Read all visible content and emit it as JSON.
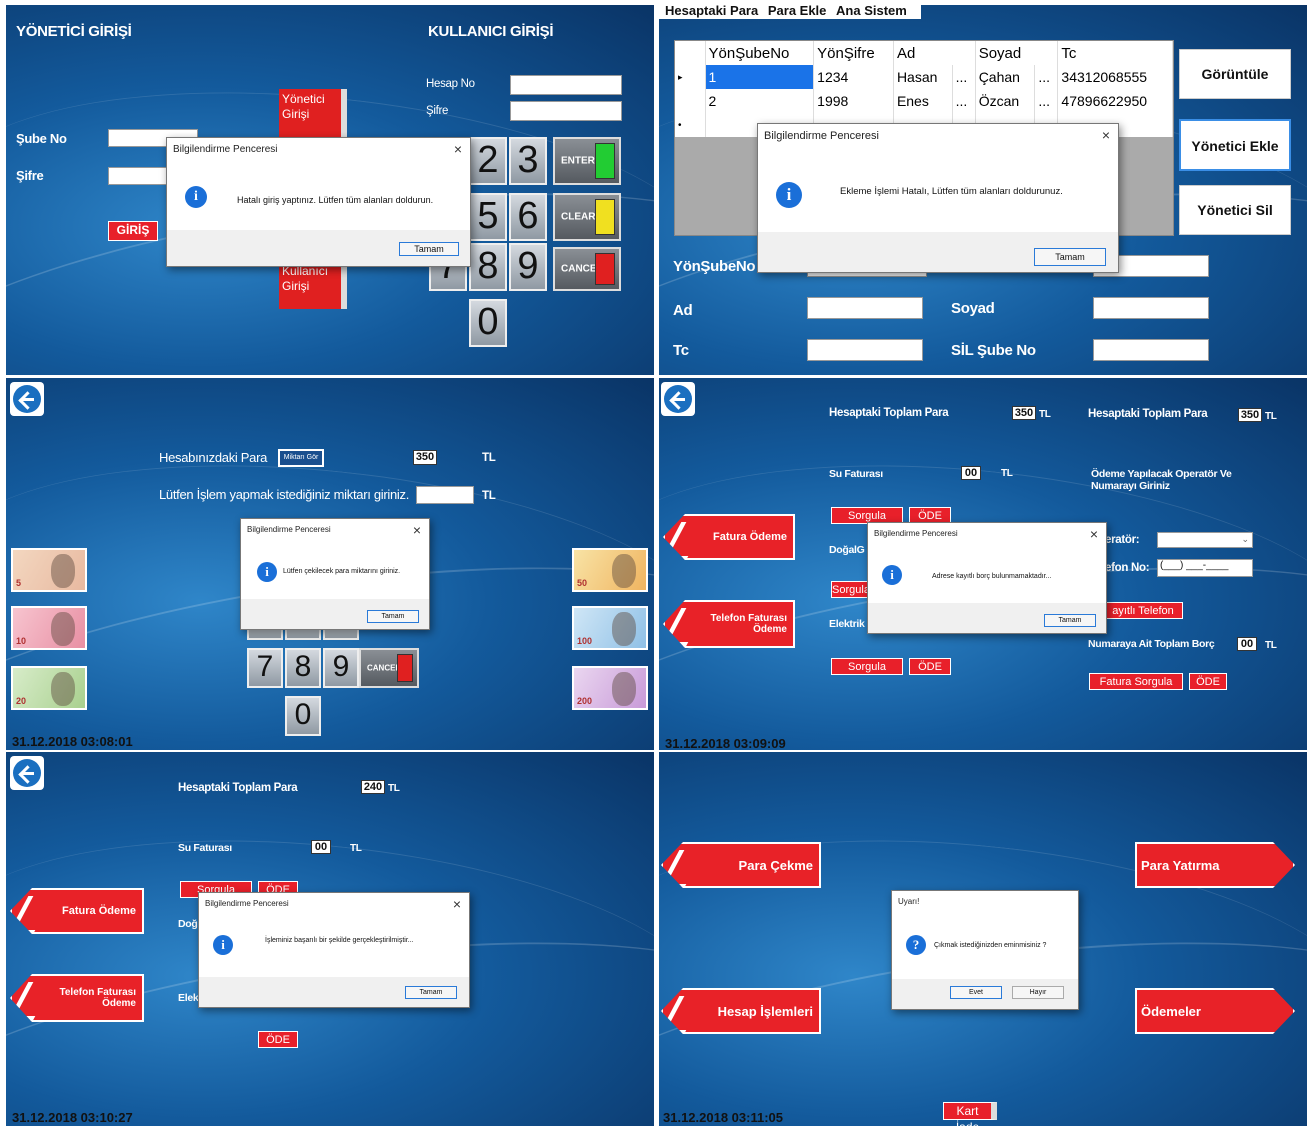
{
  "p1": {
    "admin_title": "YÖNETİCİ GİRİŞİ",
    "user_title": "KULLANICI GİRİŞİ",
    "branch_label": "Şube No",
    "pass_label": "Şifre",
    "login_button": "GİRİŞ",
    "admin_side_button": "Yönetici Girişi",
    "user_side_button": "Kullanıcı Girişi",
    "account_label": "Hesap No",
    "user_pass_label": "Şifre",
    "keys": [
      "2",
      "3",
      "5",
      "6",
      "7",
      "8",
      "9",
      "0"
    ],
    "enter": "ENTER",
    "clear": "CLEAR",
    "cancel": "CANCEL",
    "dialog": {
      "title": "Bilgilendirme Penceresi",
      "message": "Hatalı giriş yaptınız. Lütfen tüm alanları doldurun.",
      "ok": "Tamam"
    }
  },
  "p2": {
    "menu": [
      "Hesaptaki Para",
      "Para Ekle",
      "Ana Sistem"
    ],
    "columns": [
      "YönŞubeNo",
      "YönŞifre",
      "Ad",
      "Soyad",
      "Tc"
    ],
    "rows": [
      [
        "1",
        "1234",
        "Hasan",
        "Çahan",
        "34312068555"
      ],
      [
        "2",
        "1998",
        "Enes",
        "Özcan",
        "47896622950"
      ]
    ],
    "ellipsis": "...",
    "buttons": [
      "Görüntüle",
      "Yönetici Ekle",
      "Yönetici Sil"
    ],
    "branch_label": "YönŞubeNo",
    "name_label": "Ad",
    "surname_label": "Soyad",
    "tc_label": "Tc",
    "del_label": "SİL Şube No",
    "dialog": {
      "title": "Bilgilendirme Penceresi",
      "message": "Ekleme İşlemi Hatalı, Lütfen tüm alanları doldurunuz.",
      "ok": "Tamam"
    }
  },
  "p3": {
    "balance_label": "Hesabınızdaki Para",
    "show_button": "Miktarı Gör",
    "balance": "350",
    "currency": "TL",
    "amount_label": "Lütfen İşlem yapmak istediğiniz miktarı giriniz.",
    "notes_left": [
      "5",
      "10",
      "20"
    ],
    "notes_right": [
      "50",
      "100",
      "200"
    ],
    "keys": [
      "7",
      "8",
      "9",
      "0"
    ],
    "cancel": "CANCEL",
    "timestamp": "31.12.2018 03:08:01",
    "dialog": {
      "title": "Bilgilendirme Penceresi",
      "message": "Lütfen çekilecek para miktarını giriniz.",
      "ok": "Tamam"
    }
  },
  "p4": {
    "total_label": "Hesaptaki Toplam Para",
    "total": "350",
    "currency": "TL",
    "total_label2": "Hesaptaki Toplam Para",
    "total2": "350",
    "water_label": "Su Faturası",
    "water_value": "00",
    "query": "Sorgula",
    "pay": "ÖDE",
    "gas_label": "DoğalG",
    "elec_label": "Elektrik",
    "bill_button": "Fatura Ödeme",
    "phone_button": "Telefon Faturası Ödeme",
    "operator_info": "Ödeme Yapılacak Operatör Ve Numarayı Giriniz",
    "operator_label": "eratör:",
    "phone_label": "efon No:",
    "phone_mask": "(___) ___-____",
    "saved_phone": "ayıtlı Telefon",
    "debt_label": "Numaraya Ait Toplam Borç",
    "debt": "00",
    "bill_query": "Fatura Sorgula",
    "pay2": "ÖDE",
    "timestamp": "31.12.2018 03:09:09",
    "dialog": {
      "title": "Bilgilendirme Penceresi",
      "message": "Adrese kayıtlı borç bulunmamaktadır...",
      "ok": "Tamam"
    }
  },
  "p5": {
    "total_label": "Hesaptaki Toplam Para",
    "total": "240",
    "currency": "TL",
    "water_label": "Su Faturası",
    "water_value": "00",
    "query": "Sorgula",
    "pay": "ÖDE",
    "gas_label": "Doğ",
    "elec_label": "Elek",
    "bill_button": "Fatura Ödeme",
    "phone_button": "Telefon Faturası Ödeme",
    "timestamp": "31.12.2018 03:10:27",
    "dialog": {
      "title": "Bilgilendirme Penceresi",
      "message": "İşleminiz başarılı bir şekilde gerçekleştirilmiştir...",
      "ok": "Tamam"
    }
  },
  "p6": {
    "withdraw": "Para Çekme",
    "deposit": "Para Yatırma",
    "account_ops": "Hesap İşlemleri",
    "payments": "Ödemeler",
    "card_return": "Kart İade",
    "timestamp": "31.12.2018 03:11:05",
    "dialog": {
      "title": "Uyarı!",
      "message": "Çıkmak istediğinizden eminmisiniz ?",
      "yes": "Evet",
      "no": "Hayır"
    }
  },
  "colors": {
    "accent_red": "#e8202a",
    "bg_blue": "#135a9c",
    "info_blue": "#1a6fd8"
  }
}
